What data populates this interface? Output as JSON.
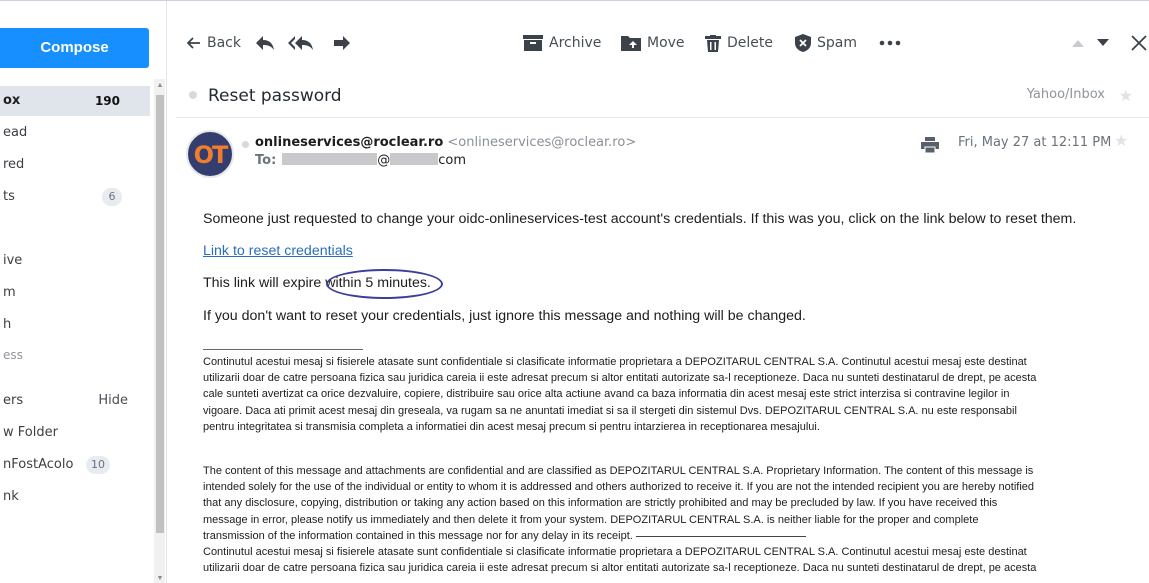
{
  "sidebar": {
    "compose": "Compose",
    "folders": [
      {
        "label": "ox",
        "count": "190",
        "active": true
      },
      {
        "label": "ead"
      },
      {
        "label": "red"
      },
      {
        "label": "ts",
        "badge": "6"
      },
      {
        "label": ""
      },
      {
        "label": "ive"
      },
      {
        "label": "m"
      },
      {
        "label": "h"
      },
      {
        "label": "ess"
      },
      {
        "label": ""
      },
      {
        "label": "ers",
        "hide": "Hide"
      },
      {
        "label": "w Folder"
      },
      {
        "label": "nFostAcolo",
        "badge": "10"
      },
      {
        "label": "nk"
      }
    ]
  },
  "toolbar": {
    "back": "Back",
    "archive": "Archive",
    "move": "Move",
    "delete": "Delete",
    "spam": "Spam"
  },
  "message": {
    "subject": "Reset password",
    "folder_path": "Yahoo/Inbox",
    "avatar_initials": "OT",
    "sender_name": "onlineservices@roclear.ro",
    "sender_address": "<onlineservices@roclear.ro>",
    "to_label": "To:",
    "to_at": "@",
    "to_suffix": "com",
    "date": "Fri, May 27 at 12:11 PM"
  },
  "body": {
    "line1": "Someone just requested to change your oidc-onlineservices-test account's credentials. If this was you, click on the link below to reset them.",
    "link": "Link to reset credentials",
    "expire_prefix": "This link will expire ",
    "expire_highlight": "within 5 minutes.",
    "line4": "If you don't want to reset your credentials, just ignore this message and nothing will be changed.",
    "ro_disclaimer_1": [
      "Continutul acestui mesaj si fisierele atasate sunt confidentiale si clasificate informatie proprietara a DEPOZITARUL CENTRAL S.A. Continutul acestui mesaj este destinat",
      "utilizarii doar de catre persoana fizica sau juridica careia ii este adresat precum si altor entitati autorizate sa-l receptioneze. Daca nu sunteti destinatarul de drept, pe acesta",
      "cale sunteti avertizat ca orice dezvaluire, copiere, distribuire sau orice alta actiune avand ca baza informatia din acest mesaj este strict interzisa si contravine legilor in",
      "vigoare. Daca ati primit acest mesaj din greseala, va rugam sa ne anuntati imediat si sa il stergeti din sistemul Dvs. DEPOZITARUL CENTRAL S.A. nu este responsabil",
      "pentru integritatea si transmisia completa a informatiei din acest mesaj precum si pentru intarzierea in receptionarea mesajului."
    ],
    "en_disclaimer": [
      "The content of this message and attachments are confidential and are classified as DEPOZITARUL CENTRAL S.A. Proprietary Information. The content of this message is",
      "intended solely for the use of the individual or entity to whom it is addressed and others authorized to receive it. If you are not the intended recipient you are hereby notified",
      "that any disclosure, copying, distribution or taking any action based on this information are strictly prohibited and may be precluded by law. If you have received this",
      "message in error, please notify us immediately and then delete it from your system. DEPOZITARUL CENTRAL S.A. is neither liable for the proper and complete",
      "transmission of the information contained in this message nor for any delay in its receipt."
    ],
    "ro_disclaimer_2": [
      "Continutul acestui mesaj si fisierele atasate sunt confidentiale si clasificate informatie proprietara a DEPOZITARUL CENTRAL S.A. Continutul acestui mesaj este destinat",
      "utilizarii doar de catre persoana fizica sau juridica careia ii este adresat precum si altor entitati autorizate sa-l receptioneze. Daca nu sunteti destinatarul de drept, pe acesta"
    ]
  },
  "colors": {
    "accent": "#188fff",
    "avatar_bg": "#333e6e",
    "avatar_fg": "#f07c2c",
    "link": "#2a6ebd"
  }
}
